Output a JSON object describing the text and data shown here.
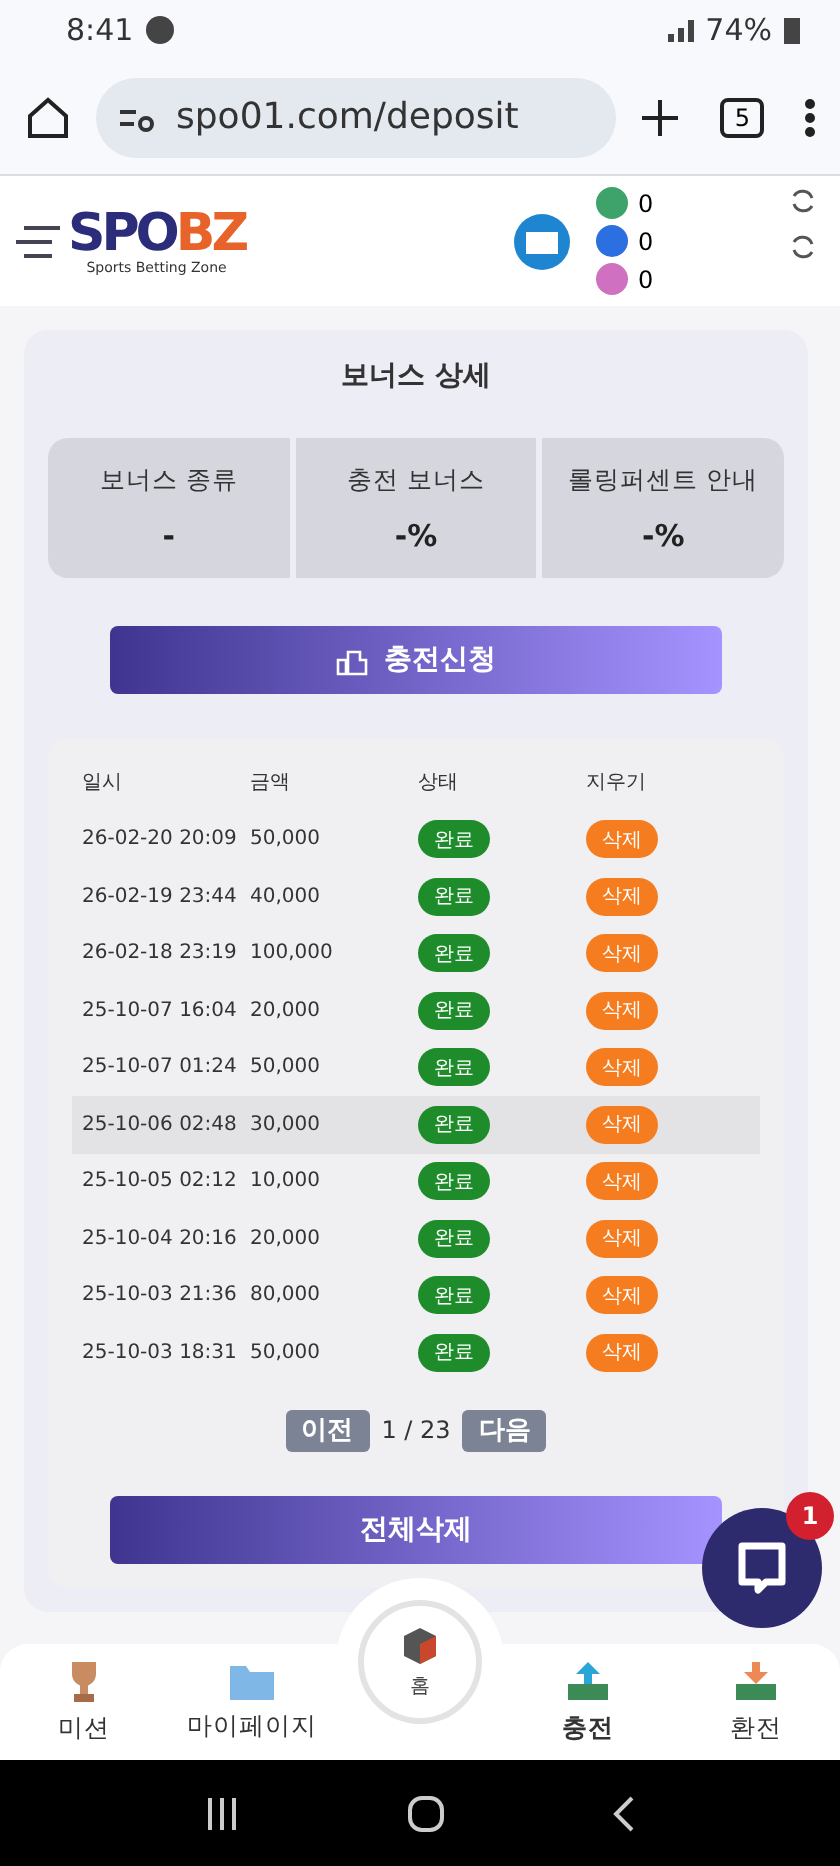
{
  "status_bar": {
    "time": "8:41",
    "battery": "74%"
  },
  "browser": {
    "url": "spo01.com/deposit",
    "tab_count": "5"
  },
  "header": {
    "logo_main": "SPO",
    "logo_accent": "BZ",
    "logo_tagline": "Sports Betting Zone",
    "balances": [
      "0",
      "0",
      "0"
    ]
  },
  "bonus": {
    "title": "보너스 상세",
    "cards": [
      {
        "label": "보너스 종류",
        "value": "-"
      },
      {
        "label": "충전 보너스",
        "value": "-%"
      },
      {
        "label": "롤링퍼센트 안내",
        "value": "-%"
      }
    ],
    "apply_button": "충전신청"
  },
  "history": {
    "columns": [
      "일시",
      "금액",
      "상태",
      "지우기"
    ],
    "rows": [
      {
        "date": "26-02-20 20:09",
        "amount": "50,000",
        "status": "완료",
        "delete": "삭제",
        "highlighted": false
      },
      {
        "date": "26-02-19 23:44",
        "amount": "40,000",
        "status": "완료",
        "delete": "삭제",
        "highlighted": false
      },
      {
        "date": "26-02-18 23:19",
        "amount": "100,000",
        "status": "완료",
        "delete": "삭제",
        "highlighted": false
      },
      {
        "date": "25-10-07 16:04",
        "amount": "20,000",
        "status": "완료",
        "delete": "삭제",
        "highlighted": false
      },
      {
        "date": "25-10-07 01:24",
        "amount": "50,000",
        "status": "완료",
        "delete": "삭제",
        "highlighted": false
      },
      {
        "date": "25-10-06 02:48",
        "amount": "30,000",
        "status": "완료",
        "delete": "삭제",
        "highlighted": true
      },
      {
        "date": "25-10-05 02:12",
        "amount": "10,000",
        "status": "완료",
        "delete": "삭제",
        "highlighted": false
      },
      {
        "date": "25-10-04 20:16",
        "amount": "20,000",
        "status": "완료",
        "delete": "삭제",
        "highlighted": false
      },
      {
        "date": "25-10-03 21:36",
        "amount": "80,000",
        "status": "완료",
        "delete": "삭제",
        "highlighted": false
      },
      {
        "date": "25-10-03 18:31",
        "amount": "50,000",
        "status": "완료",
        "delete": "삭제",
        "highlighted": false
      }
    ],
    "pagination": {
      "prev": "이전",
      "page": "1 / 23",
      "next": "다음"
    },
    "delete_all": "전체삭제"
  },
  "chat": {
    "badge": "1"
  },
  "bottom_nav": [
    {
      "kind": "trophy",
      "label": "미션",
      "selected": false
    },
    {
      "kind": "folder",
      "label": "마이페이지",
      "selected": false
    },
    {
      "kind": "home",
      "label": "홈",
      "selected": false
    },
    {
      "kind": "deposit",
      "label": "충전",
      "selected": true
    },
    {
      "kind": "withdraw",
      "label": "환전",
      "selected": false
    }
  ]
}
